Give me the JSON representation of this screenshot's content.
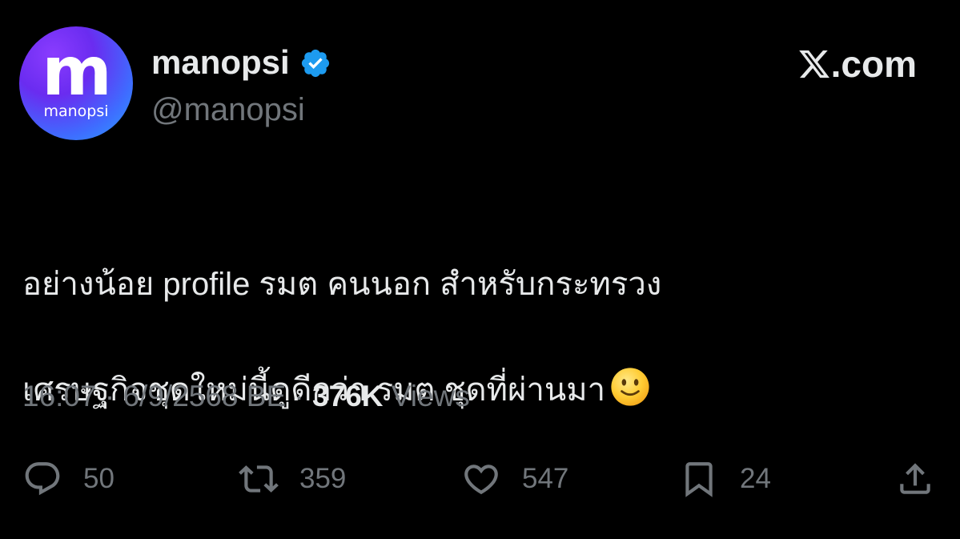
{
  "author": {
    "avatar_letter": "m",
    "avatar_word": "manopsi",
    "display_name": "manopsi",
    "handle": "@manopsi",
    "verified": true
  },
  "brand": {
    "text": ".com",
    "icon": "x-logo-icon"
  },
  "tweet": {
    "line1": "อย่างน้อย profile รมต คนนอก สำหรับกระทรวง",
    "line2": "เศรษฐกิจชุดใหม่นี้ดูดีกว่า รมต ชุดที่ผ่านมา",
    "emoji": "slightly-smiling-face-icon"
  },
  "meta": {
    "time": "16:07",
    "sep1": " · ",
    "date": "6/9/2568 BE",
    "sep2": " · ",
    "views_count": "376K",
    "views_label": " Views"
  },
  "actions": {
    "replies": "50",
    "reposts": "359",
    "likes": "547",
    "bookmarks": "24"
  },
  "colors": {
    "background": "#000000",
    "text": "#e7e9ea",
    "secondary": "#71767b",
    "verified": "#1d9bf0"
  }
}
